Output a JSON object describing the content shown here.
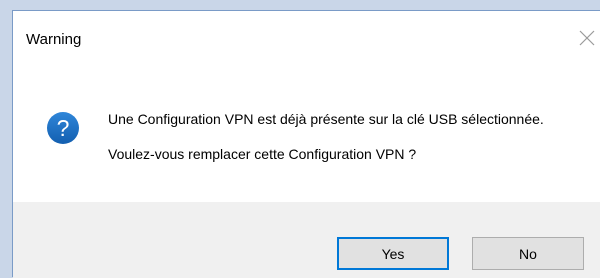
{
  "dialog": {
    "title": "Warning",
    "message_line1": "Une Configuration VPN est déjà présente sur la clé USB sélectionnée.",
    "message_line2": "Voulez-vous remplacer cette Configuration VPN ?",
    "icon": "question-icon",
    "buttons": {
      "yes": "Yes",
      "no": "No"
    }
  },
  "colors": {
    "accent": "#0078d7",
    "icon_blue": "#1a6fc4",
    "footer_bg": "#f0f0f0",
    "desktop_bg": "#c9d6e8"
  }
}
